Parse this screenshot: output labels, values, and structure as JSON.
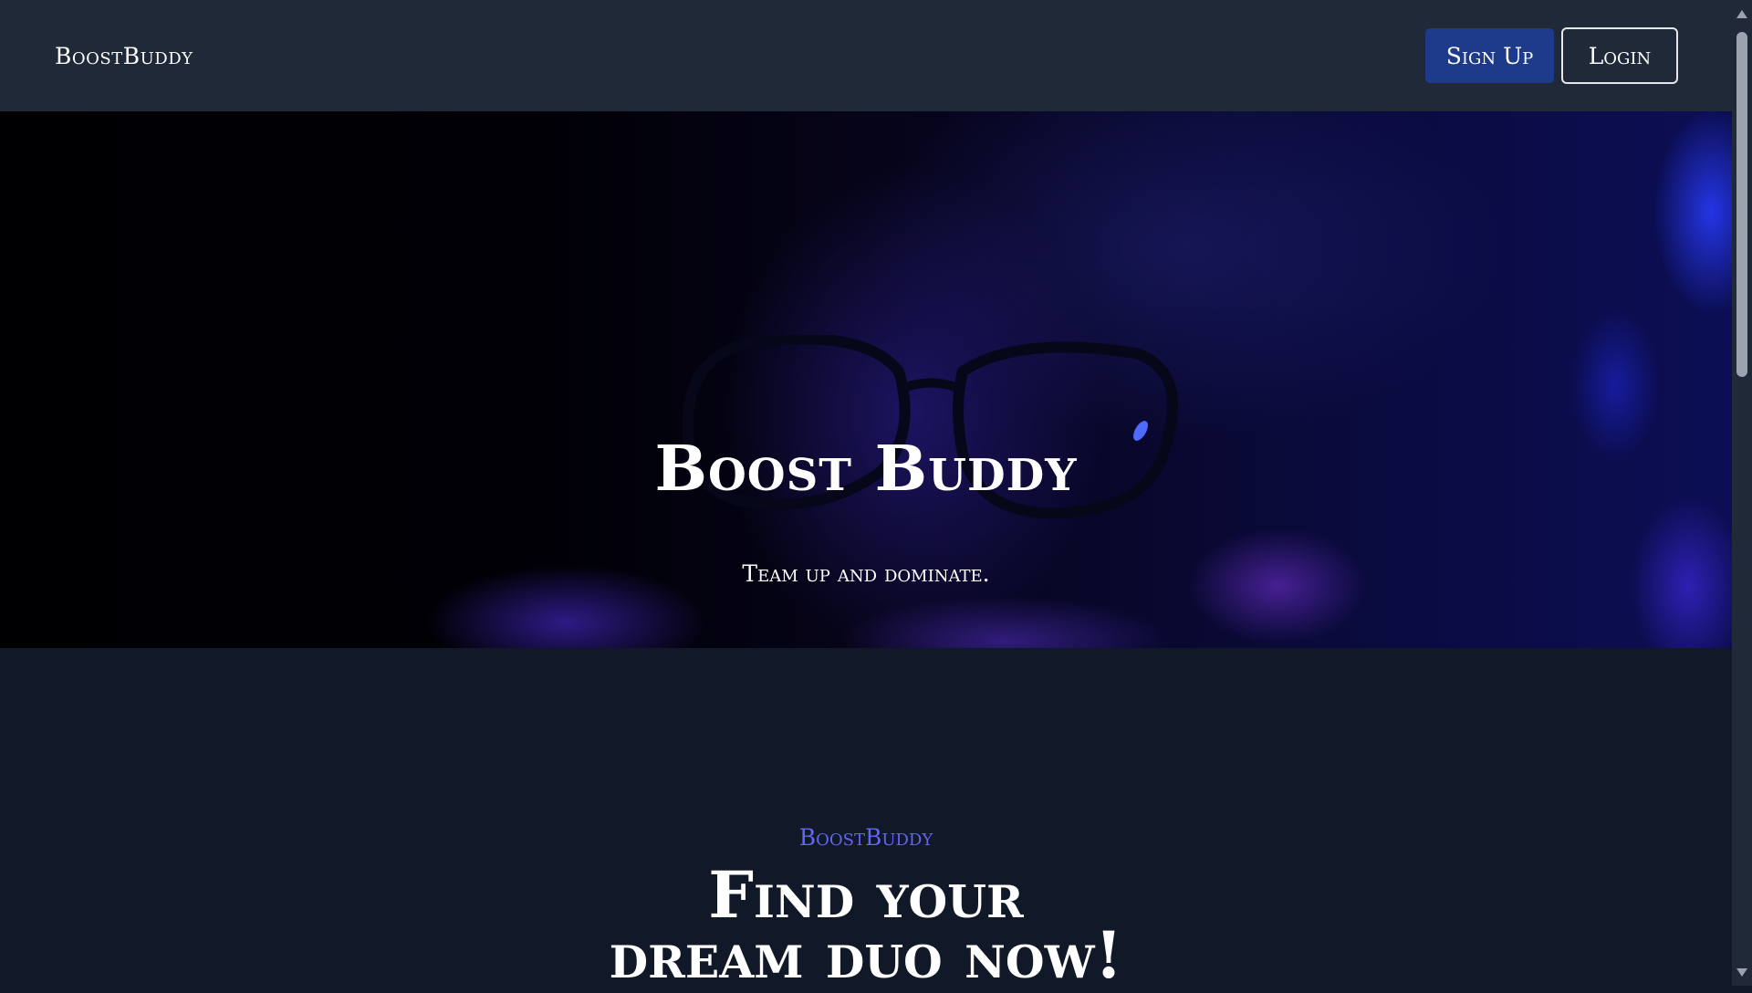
{
  "header": {
    "brand": "BoostBuddy",
    "signup_label": "Sign Up",
    "login_label": "Login"
  },
  "hero": {
    "title": "Boost Buddy",
    "subtitle": "Team up and dominate."
  },
  "section": {
    "eyebrow": "BoostBuddy",
    "headline_line1": "Find your",
    "headline_line2": "dream duo now!"
  },
  "colors": {
    "header_bg": "#1f2937",
    "page_bg": "#111827",
    "signup_bg": "#1e3a8a",
    "accent": "#6366f1"
  }
}
